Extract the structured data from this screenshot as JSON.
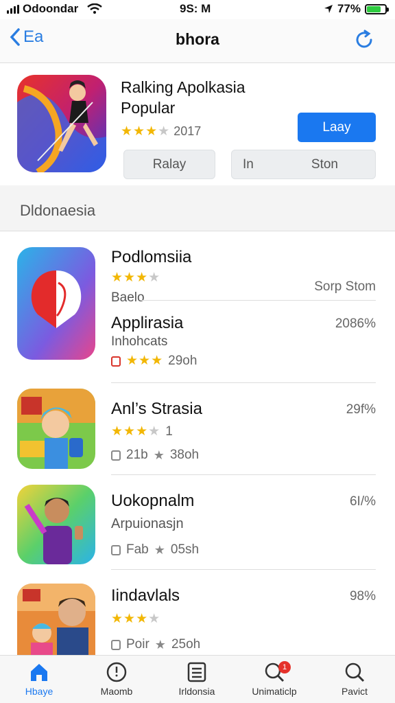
{
  "status_bar": {
    "carrier": "Odoondar",
    "time": "9S: M",
    "battery": "77%",
    "battery_level": 0.77
  },
  "nav": {
    "back_label": "Ea",
    "title": "bhora"
  },
  "featured": {
    "title": "Ralking Apolkasia Popular",
    "rating": 3,
    "rating_count": "2017",
    "get_label": "Laay",
    "seg_left": "Ralay",
    "seg_right_a": "In",
    "seg_right_b": "Ston"
  },
  "section": {
    "title": "Dldonaesia"
  },
  "apps": [
    {
      "name": "Podlomsiia",
      "rating": 3,
      "sub": "Baelo",
      "right": "Sorp Stom"
    },
    {
      "name": "Applirasia",
      "sub": "Inhohcats",
      "rating": 3,
      "count": "29oh",
      "pct": "2086%"
    },
    {
      "name": "Anl’s Strasia",
      "rating": 3,
      "rating_tail": "1",
      "size": "21b",
      "count": "38oh",
      "pct": "29f%"
    },
    {
      "name": "Uokopnalm",
      "sub": "Arpuionasjn",
      "size": "Fab",
      "count": "05sh",
      "pct": "6I/%"
    },
    {
      "name": "Iindavlals",
      "rating": 3,
      "size": "Poir",
      "count": "25oh",
      "pct": "98%"
    }
  ],
  "tabs": [
    {
      "label": "Hbaye",
      "icon": "home-icon"
    },
    {
      "label": "Maomb",
      "icon": "clock-icon"
    },
    {
      "label": "Irldonsia",
      "icon": "list-icon"
    },
    {
      "label": "Unimaticlp",
      "icon": "search-notify-icon",
      "badge": "1"
    },
    {
      "label": "Pavict",
      "icon": "search-icon"
    }
  ],
  "colors": {
    "accent": "#1a78f0",
    "star": "#f2b705",
    "badge": "#e5322b"
  }
}
